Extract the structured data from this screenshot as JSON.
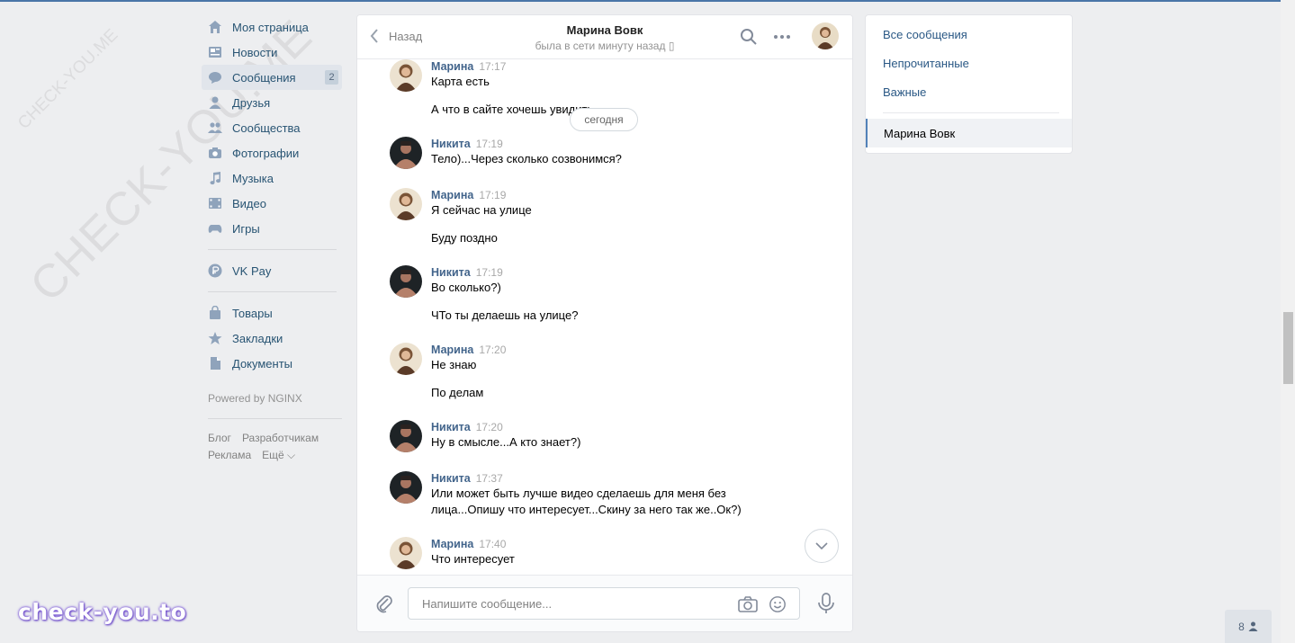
{
  "watermark": {
    "big": "CHECK-YOU.ME",
    "small": "CHECK-YOU.ME",
    "brand": "check-you.to"
  },
  "sidebar": {
    "items": [
      {
        "label": "Моя страница",
        "icon": "home-icon"
      },
      {
        "label": "Новости",
        "icon": "news-icon"
      },
      {
        "label": "Сообщения",
        "icon": "messages-icon",
        "badge": "2",
        "active": true
      },
      {
        "label": "Друзья",
        "icon": "friends-icon"
      },
      {
        "label": "Сообщества",
        "icon": "communities-icon"
      },
      {
        "label": "Фотографии",
        "icon": "camera-icon"
      },
      {
        "label": "Музыка",
        "icon": "music-icon"
      },
      {
        "label": "Видео",
        "icon": "video-icon"
      },
      {
        "label": "Игры",
        "icon": "games-icon"
      }
    ],
    "vkpay": {
      "label": "VK Pay",
      "icon": "ruble-icon"
    },
    "extra": [
      {
        "label": "Товары",
        "icon": "bag-icon"
      },
      {
        "label": "Закладки",
        "icon": "star-icon"
      },
      {
        "label": "Документы",
        "icon": "document-icon"
      }
    ],
    "powered": "Powered by NGINX",
    "footer": {
      "blog": "Блог",
      "dev": "Разработчикам",
      "ads": "Реклама",
      "more": "Ещё ⌵"
    }
  },
  "chat": {
    "back_label": "Назад",
    "peer_name": "Марина Вовк",
    "peer_status": "была в сети минуту назад",
    "day_label": "сегодня",
    "messages": [
      {
        "author": "Марина",
        "time": "17:17",
        "lines": [
          "Карта есть",
          "",
          "А что в сайте хочешь увидить"
        ]
      },
      {
        "author": "Никита",
        "time": "17:19",
        "lines": [
          "Тело)...Через сколько созвонимся?"
        ]
      },
      {
        "author": "Марина",
        "time": "17:19",
        "lines": [
          "Я сейчас на улице",
          "",
          "Буду поздно"
        ]
      },
      {
        "author": "Никита",
        "time": "17:19",
        "lines": [
          "Во сколько?)",
          "",
          "ЧТо ты делаешь на улице?"
        ]
      },
      {
        "author": "Марина",
        "time": "17:20",
        "lines": [
          "Не знаю",
          "",
          "По делам"
        ]
      },
      {
        "author": "Никита",
        "time": "17:20",
        "lines": [
          "Ну в смысле...А кто знает?)"
        ]
      },
      {
        "author": "Никита",
        "time": "17:37",
        "lines": [
          "Или может быть лучше видео сделаешь для меня без",
          "лица...Опишу что интересует...Скину за него так же..Ок?)"
        ]
      },
      {
        "author": "Марина",
        "time": "17:40",
        "lines": [
          "Что интересует"
        ]
      }
    ],
    "composer_placeholder": "Напишите сообщение..."
  },
  "filters": {
    "all": "Все сообщения",
    "unread": "Непрочитанные",
    "important": "Важные",
    "conversation": "Марина Вовк"
  },
  "online_count": "8",
  "colors": {
    "accent": "#4a76a8",
    "link": "#2a5885",
    "author": "#42648b"
  }
}
